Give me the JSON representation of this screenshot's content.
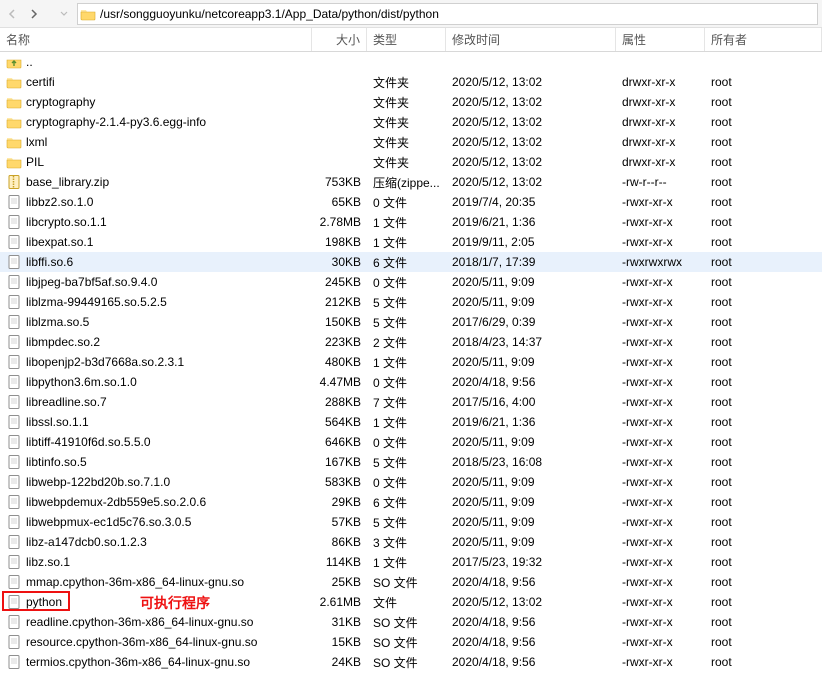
{
  "path": "/usr/songguoyunku/netcoreapp3.1/App_Data/python/dist/python",
  "header": {
    "name": "名称",
    "size": "大小",
    "type": "类型",
    "mod": "修改时间",
    "attr": "属性",
    "own": "所有者"
  },
  "annotation": "可执行程序",
  "rows": [
    {
      "icon": "updir",
      "name": "..",
      "size": "",
      "type": "",
      "mod": "",
      "attr": "",
      "own": ""
    },
    {
      "icon": "folder",
      "name": "certifi",
      "size": "",
      "type": "文件夹",
      "mod": "2020/5/12, 13:02",
      "attr": "drwxr-xr-x",
      "own": "root"
    },
    {
      "icon": "folder",
      "name": "cryptography",
      "size": "",
      "type": "文件夹",
      "mod": "2020/5/12, 13:02",
      "attr": "drwxr-xr-x",
      "own": "root"
    },
    {
      "icon": "folder",
      "name": "cryptography-2.1.4-py3.6.egg-info",
      "size": "",
      "type": "文件夹",
      "mod": "2020/5/12, 13:02",
      "attr": "drwxr-xr-x",
      "own": "root"
    },
    {
      "icon": "folder",
      "name": "lxml",
      "size": "",
      "type": "文件夹",
      "mod": "2020/5/12, 13:02",
      "attr": "drwxr-xr-x",
      "own": "root"
    },
    {
      "icon": "folder",
      "name": "PIL",
      "size": "",
      "type": "文件夹",
      "mod": "2020/5/12, 13:02",
      "attr": "drwxr-xr-x",
      "own": "root"
    },
    {
      "icon": "zip",
      "name": "base_library.zip",
      "size": "753KB",
      "type": "压缩(zippe...",
      "mod": "2020/5/12, 13:02",
      "attr": "-rw-r--r--",
      "own": "root"
    },
    {
      "icon": "file",
      "name": "libbz2.so.1.0",
      "size": "65KB",
      "type": "0 文件",
      "mod": "2019/7/4, 20:35",
      "attr": "-rwxr-xr-x",
      "own": "root"
    },
    {
      "icon": "file",
      "name": "libcrypto.so.1.1",
      "size": "2.78MB",
      "type": "1 文件",
      "mod": "2019/6/21, 1:36",
      "attr": "-rwxr-xr-x",
      "own": "root"
    },
    {
      "icon": "file",
      "name": "libexpat.so.1",
      "size": "198KB",
      "type": "1 文件",
      "mod": "2019/9/11, 2:05",
      "attr": "-rwxr-xr-x",
      "own": "root"
    },
    {
      "icon": "file",
      "name": "libffi.so.6",
      "size": "30KB",
      "type": "6 文件",
      "mod": "2018/1/7, 17:39",
      "attr": "-rwxrwxrwx",
      "own": "root",
      "sel": true
    },
    {
      "icon": "file",
      "name": "libjpeg-ba7bf5af.so.9.4.0",
      "size": "245KB",
      "type": "0 文件",
      "mod": "2020/5/11, 9:09",
      "attr": "-rwxr-xr-x",
      "own": "root"
    },
    {
      "icon": "file",
      "name": "liblzma-99449165.so.5.2.5",
      "size": "212KB",
      "type": "5 文件",
      "mod": "2020/5/11, 9:09",
      "attr": "-rwxr-xr-x",
      "own": "root"
    },
    {
      "icon": "file",
      "name": "liblzma.so.5",
      "size": "150KB",
      "type": "5 文件",
      "mod": "2017/6/29, 0:39",
      "attr": "-rwxr-xr-x",
      "own": "root"
    },
    {
      "icon": "file",
      "name": "libmpdec.so.2",
      "size": "223KB",
      "type": "2 文件",
      "mod": "2018/4/23, 14:37",
      "attr": "-rwxr-xr-x",
      "own": "root"
    },
    {
      "icon": "file",
      "name": "libopenjp2-b3d7668a.so.2.3.1",
      "size": "480KB",
      "type": "1 文件",
      "mod": "2020/5/11, 9:09",
      "attr": "-rwxr-xr-x",
      "own": "root"
    },
    {
      "icon": "file",
      "name": "libpython3.6m.so.1.0",
      "size": "4.47MB",
      "type": "0 文件",
      "mod": "2020/4/18, 9:56",
      "attr": "-rwxr-xr-x",
      "own": "root"
    },
    {
      "icon": "file",
      "name": "libreadline.so.7",
      "size": "288KB",
      "type": "7 文件",
      "mod": "2017/5/16, 4:00",
      "attr": "-rwxr-xr-x",
      "own": "root"
    },
    {
      "icon": "file",
      "name": "libssl.so.1.1",
      "size": "564KB",
      "type": "1 文件",
      "mod": "2019/6/21, 1:36",
      "attr": "-rwxr-xr-x",
      "own": "root"
    },
    {
      "icon": "file",
      "name": "libtiff-41910f6d.so.5.5.0",
      "size": "646KB",
      "type": "0 文件",
      "mod": "2020/5/11, 9:09",
      "attr": "-rwxr-xr-x",
      "own": "root"
    },
    {
      "icon": "file",
      "name": "libtinfo.so.5",
      "size": "167KB",
      "type": "5 文件",
      "mod": "2018/5/23, 16:08",
      "attr": "-rwxr-xr-x",
      "own": "root"
    },
    {
      "icon": "file",
      "name": "libwebp-122bd20b.so.7.1.0",
      "size": "583KB",
      "type": "0 文件",
      "mod": "2020/5/11, 9:09",
      "attr": "-rwxr-xr-x",
      "own": "root"
    },
    {
      "icon": "file",
      "name": "libwebpdemux-2db559e5.so.2.0.6",
      "size": "29KB",
      "type": "6 文件",
      "mod": "2020/5/11, 9:09",
      "attr": "-rwxr-xr-x",
      "own": "root"
    },
    {
      "icon": "file",
      "name": "libwebpmux-ec1d5c76.so.3.0.5",
      "size": "57KB",
      "type": "5 文件",
      "mod": "2020/5/11, 9:09",
      "attr": "-rwxr-xr-x",
      "own": "root"
    },
    {
      "icon": "file",
      "name": "libz-a147dcb0.so.1.2.3",
      "size": "86KB",
      "type": "3 文件",
      "mod": "2020/5/11, 9:09",
      "attr": "-rwxr-xr-x",
      "own": "root"
    },
    {
      "icon": "file",
      "name": "libz.so.1",
      "size": "114KB",
      "type": "1 文件",
      "mod": "2017/5/23, 19:32",
      "attr": "-rwxr-xr-x",
      "own": "root"
    },
    {
      "icon": "file",
      "name": "mmap.cpython-36m-x86_64-linux-gnu.so",
      "size": "25KB",
      "type": "SO 文件",
      "mod": "2020/4/18, 9:56",
      "attr": "-rwxr-xr-x",
      "own": "root"
    },
    {
      "icon": "file",
      "name": "python",
      "size": "2.61MB",
      "type": "文件",
      "mod": "2020/5/12, 13:02",
      "attr": "-rwxr-xr-x",
      "own": "root",
      "boxed": true
    },
    {
      "icon": "file",
      "name": "readline.cpython-36m-x86_64-linux-gnu.so",
      "size": "31KB",
      "type": "SO 文件",
      "mod": "2020/4/18, 9:56",
      "attr": "-rwxr-xr-x",
      "own": "root"
    },
    {
      "icon": "file",
      "name": "resource.cpython-36m-x86_64-linux-gnu.so",
      "size": "15KB",
      "type": "SO 文件",
      "mod": "2020/4/18, 9:56",
      "attr": "-rwxr-xr-x",
      "own": "root"
    },
    {
      "icon": "file",
      "name": "termios.cpython-36m-x86_64-linux-gnu.so",
      "size": "24KB",
      "type": "SO 文件",
      "mod": "2020/4/18, 9:56",
      "attr": "-rwxr-xr-x",
      "own": "root"
    }
  ]
}
